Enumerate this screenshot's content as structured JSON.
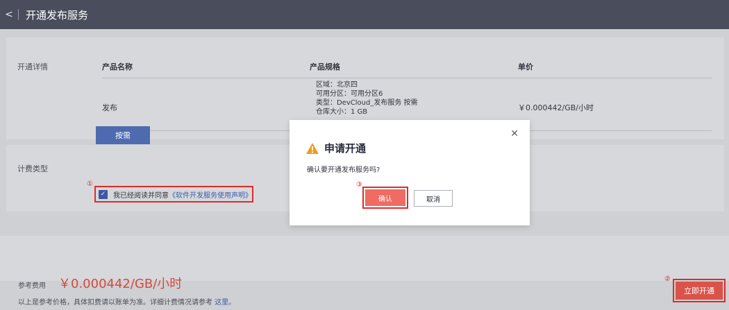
{
  "header": {
    "back_icon": "chevron-left-icon",
    "title": "开通发布服务"
  },
  "details": {
    "row_label": "开通详情",
    "columns": [
      "产品名称",
      "产品规格",
      "单价"
    ],
    "product_name": "发布",
    "spec_lines": [
      "区域：北京四",
      "可用分区：可用分区6",
      "类型：DevCloud_发布服务 按需",
      "仓库大小：1 GB"
    ],
    "unit_price": "￥0.000442/GB/小时"
  },
  "billing": {
    "row_label": "计费类型",
    "on_demand_label": "按需",
    "agreement_prefix": "我已经阅读并同意",
    "agreement_link": "《软件开发服务使用声明》",
    "checked": true
  },
  "markers": {
    "m1": "①",
    "m2": "②",
    "m3": "③"
  },
  "footer": {
    "fee_label": "参考费用",
    "fee_price": "￥0.000442/GB/小时",
    "note_prefix": "以上是参考价格，具体扣费请以账单为准。详细计费情况请参考",
    "note_link": "这里。",
    "open_button": "立即开通"
  },
  "modal": {
    "title": "申请开通",
    "message": "确认要开通发布服务吗?",
    "confirm": "确认",
    "cancel": "取消",
    "close_icon": "close-icon",
    "warning_icon": "warning-icon"
  },
  "colors": {
    "topbar": "#4a4d5c",
    "accent": "#4e6bb0",
    "danger": "#d9534b",
    "highlight": "#e02a2a"
  }
}
